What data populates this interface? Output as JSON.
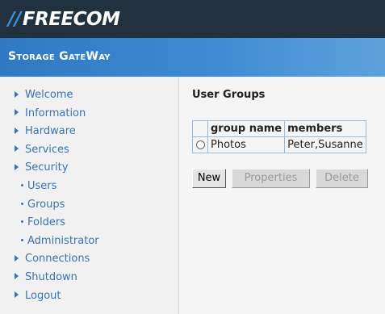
{
  "header": {
    "logo_text": "FREECOM",
    "logo_slashes": "//",
    "subtitle": "Storage GateWay"
  },
  "sidebar": {
    "items": [
      {
        "label": "Welcome",
        "type": "section"
      },
      {
        "label": "Information",
        "type": "section"
      },
      {
        "label": "Hardware",
        "type": "section"
      },
      {
        "label": "Services",
        "type": "section"
      },
      {
        "label": "Security",
        "type": "section"
      },
      {
        "label": "Users",
        "type": "sub"
      },
      {
        "label": "Groups",
        "type": "sub"
      },
      {
        "label": "Folders",
        "type": "sub"
      },
      {
        "label": "Administrator",
        "type": "sub"
      },
      {
        "label": "Connections",
        "type": "section"
      },
      {
        "label": "Shutdown",
        "type": "section"
      },
      {
        "label": "Logout",
        "type": "section"
      }
    ]
  },
  "main": {
    "title": "User Groups",
    "table": {
      "headers": [
        "group name",
        "members"
      ],
      "rows": [
        {
          "group_name": "Photos",
          "members": "Peter,Susanne"
        }
      ]
    },
    "buttons": {
      "new": "New",
      "properties": "Properties",
      "delete": "Delete"
    }
  },
  "colors": {
    "topbar": "#22313f",
    "subbar": "#3e8bd3",
    "link": "#3a73b5"
  }
}
